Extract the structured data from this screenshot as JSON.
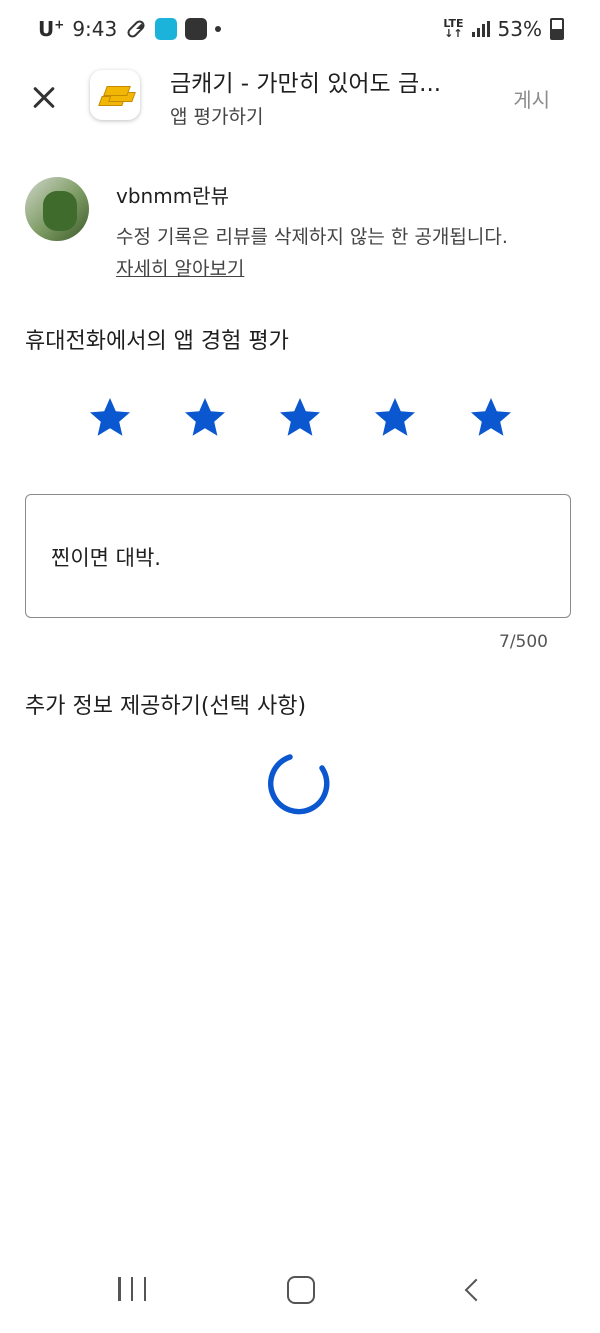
{
  "status_bar": {
    "carrier": "U",
    "carrier_sup": "+",
    "time": "9:43",
    "network": "LTE",
    "battery": "53%",
    "icons": [
      "pill-icon",
      "app-s-icon",
      "gallery-icon",
      "notification-dot",
      "lte-icon",
      "signal-icon",
      "battery-icon"
    ]
  },
  "header": {
    "app_title": "금캐기 - 가만히 있어도 금...",
    "subtitle": "앱 평가하기",
    "post_label": "게시"
  },
  "profile": {
    "username": "vbnmm란뷰",
    "notice": "수정 기록은 리뷰를 삭제하지 않는 한 공개됩니다.",
    "learn_more": "자세히 알아보기"
  },
  "rating": {
    "heading": "휴대전화에서의 앱 경험 평가",
    "value": 5,
    "max": 5
  },
  "review": {
    "text": "찐이면 대박.",
    "char_count": "7/500"
  },
  "optional": {
    "heading": "추가 정보 제공하기(선택 사항)"
  },
  "colors": {
    "star": "#0b57d0",
    "spinner": "#0b57d0",
    "post_disabled": "#8c8c8c"
  }
}
